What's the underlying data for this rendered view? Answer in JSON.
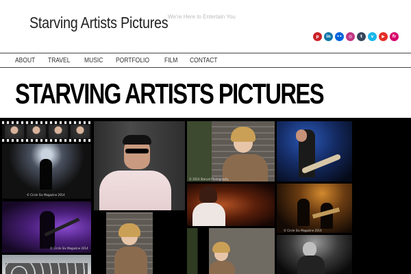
{
  "site": {
    "title": "Starving Artists Pictures",
    "tagline": "We're Here to Entertain You"
  },
  "social": [
    {
      "icon": "pinterest-icon",
      "glyph": "p",
      "color": "#cb2027"
    },
    {
      "icon": "linkedin-icon",
      "glyph": "in",
      "color": "#0e76a8"
    },
    {
      "icon": "flickr-icon",
      "glyph": "••",
      "color": "#0063dc"
    },
    {
      "icon": "instagram-icon",
      "glyph": "◎",
      "color": "#c13584"
    },
    {
      "icon": "tumblr-icon",
      "glyph": "t",
      "color": "#35465c"
    },
    {
      "icon": "vimeo-icon",
      "glyph": "v",
      "color": "#1ab7ea"
    },
    {
      "icon": "youtube-icon",
      "glyph": "▶",
      "color": "#e52d27"
    },
    {
      "icon": "fivehundredpx-icon",
      "glyph": "fr",
      "color": "#d6006b"
    }
  ],
  "nav": {
    "items": [
      "About",
      "Travel",
      "Music",
      "Portfolio",
      "Film",
      "Contact"
    ]
  },
  "page": {
    "heading": "STARVING ARTISTS PICTURES"
  },
  "gallery": {
    "watermarks": {
      "concert_1": "© Circle Six Magazine 2014",
      "portrait_1": "© 2014 Staruel Photography",
      "concert_2": "© Circle Six Magazine 2014",
      "concert_3": "© Circle Six Magazine 2014"
    }
  },
  "colors": {
    "accent": "#000000",
    "nav_border": "#444444"
  }
}
